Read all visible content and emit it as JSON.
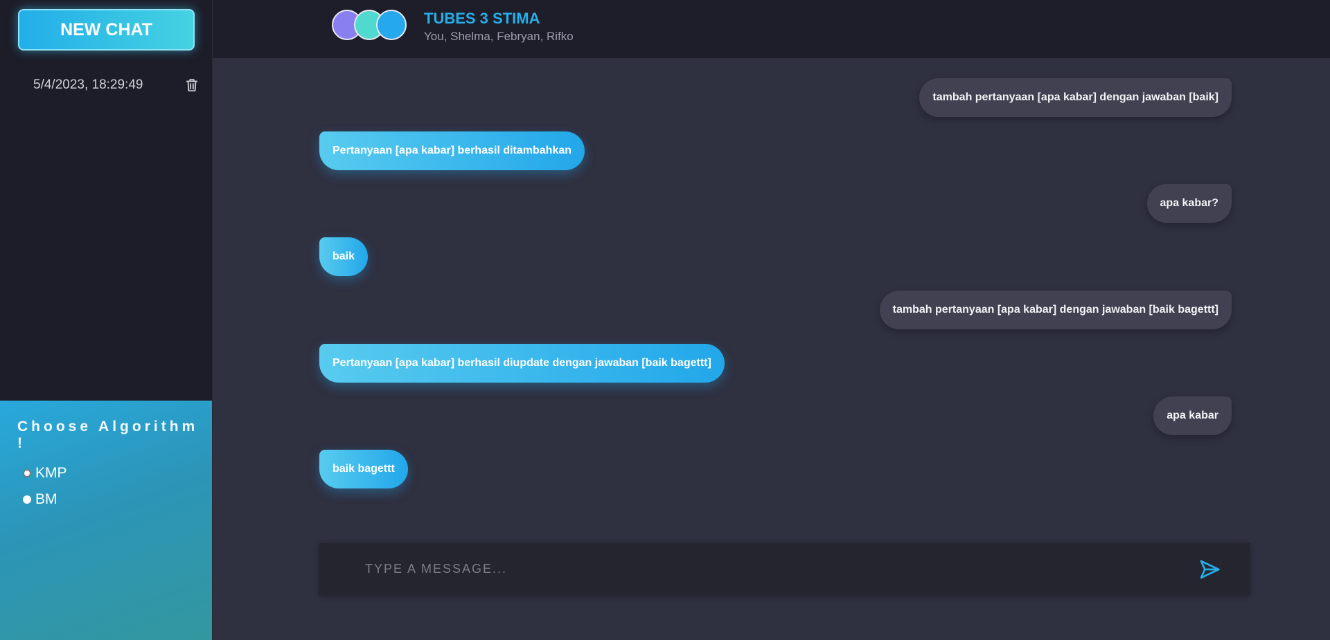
{
  "sidebar": {
    "new_chat_label": "NEW CHAT",
    "history": [
      {
        "timestamp": "5/4/2023, 18:29:49"
      }
    ],
    "algorithm_title": "Choose Algorithm !",
    "algorithms": [
      {
        "label": "KMP",
        "selected": true
      },
      {
        "label": "BM",
        "selected": false
      }
    ]
  },
  "header": {
    "title": "TUBES 3 STIMA",
    "participants": "You, Shelma, Febryan, Rifko",
    "avatar_colors": [
      "#8a7ff0",
      "#4fd9cf",
      "#26a8ee"
    ]
  },
  "messages": [
    {
      "from": "user",
      "text": "tambah pertanyaan [apa kabar] dengan jawaban [baik]"
    },
    {
      "from": "bot",
      "text": "Pertanyaan [apa kabar] berhasil ditambahkan"
    },
    {
      "from": "user",
      "text": "apa kabar?"
    },
    {
      "from": "bot",
      "text": "baik"
    },
    {
      "from": "user",
      "text": "tambah pertanyaan [apa kabar] dengan jawaban [baik bagettt]"
    },
    {
      "from": "bot",
      "text": "Pertanyaan [apa kabar] berhasil diupdate dengan jawaban [baik bagettt]"
    },
    {
      "from": "user",
      "text": "apa kabar"
    },
    {
      "from": "bot",
      "text": "baik bagettt"
    }
  ],
  "composer": {
    "placeholder": "TYPE A MESSAGE...",
    "value": ""
  },
  "colors": {
    "accent": "#26aee8",
    "sidebar_bg": "#1d1d29",
    "chat_bg": "#2f3040",
    "user_bubble": "#414151"
  },
  "icons": {
    "delete": "trash-icon",
    "send": "send-icon"
  }
}
